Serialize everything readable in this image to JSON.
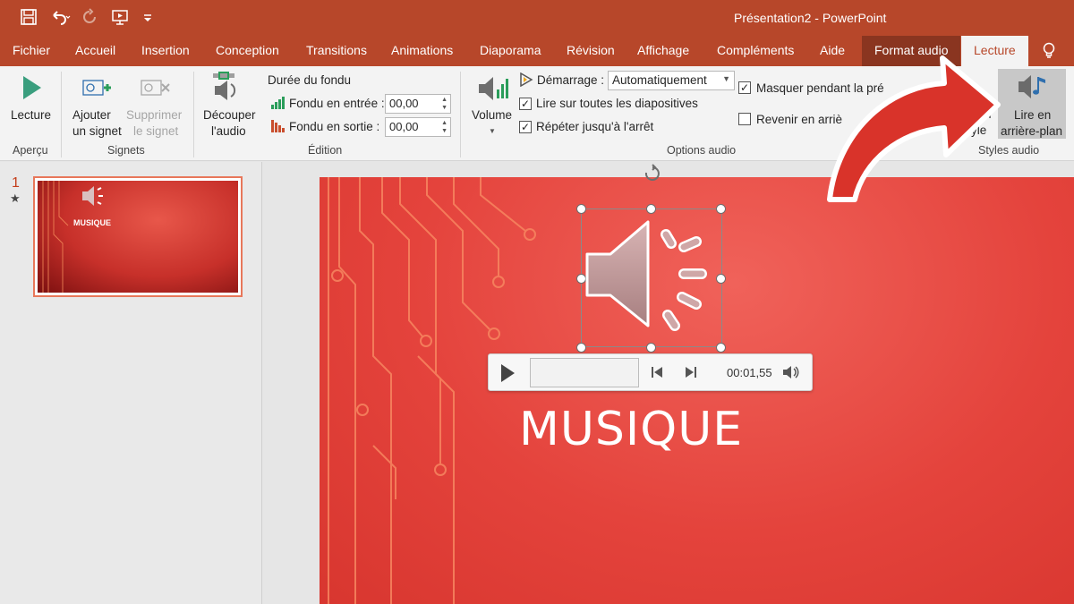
{
  "window": {
    "title": "Présentation2  -  PowerPoint"
  },
  "colors": {
    "accent": "#b7472a",
    "slide_bg": "#e4433c",
    "arrow": "#d9332a"
  },
  "tabs": [
    {
      "label": "Fichier"
    },
    {
      "label": "Accueil"
    },
    {
      "label": "Insertion"
    },
    {
      "label": "Conception"
    },
    {
      "label": "Transitions"
    },
    {
      "label": "Animations"
    },
    {
      "label": "Diaporama"
    },
    {
      "label": "Révision"
    },
    {
      "label": "Affichage"
    },
    {
      "label": "Compléments"
    },
    {
      "label": "Aide"
    },
    {
      "label": "Format audio"
    },
    {
      "label": "Lecture"
    }
  ],
  "ribbon": {
    "apercu": {
      "play": "Lecture",
      "group": "Aperçu"
    },
    "signets": {
      "add_1": "Ajouter",
      "add_2": "un signet",
      "remove_1": "Supprimer",
      "remove_2": "le signet",
      "group": "Signets"
    },
    "edition": {
      "trim_1": "Découper",
      "trim_2": "l'audio",
      "fade_title": "Durée du fondu",
      "fade_in_label": "Fondu en entrée :",
      "fade_in_value": "00,00",
      "fade_out_label": "Fondu en sortie :",
      "fade_out_value": "00,00",
      "group": "Édition"
    },
    "options": {
      "volume": "Volume",
      "start_label": "Démarrage :",
      "start_value": "Automatiquement",
      "play_across": "Lire sur toutes les diapositives",
      "loop": "Répéter jusqu'à l'arrêt",
      "hide": "Masquer pendant la pré",
      "rewind": "Revenir en arriè",
      "group": "Options audio"
    },
    "styles": {
      "partial_1": "n",
      "partial_2": "yle",
      "bg_1": "Lire en",
      "bg_2": "arrière-plan",
      "group": "Styles audio"
    }
  },
  "slides_pane": {
    "number": "1",
    "marker": "★",
    "thumb_title": "MUSIQUE"
  },
  "slide": {
    "title": "MUSIQUE"
  },
  "player": {
    "time": "00:01,55"
  }
}
